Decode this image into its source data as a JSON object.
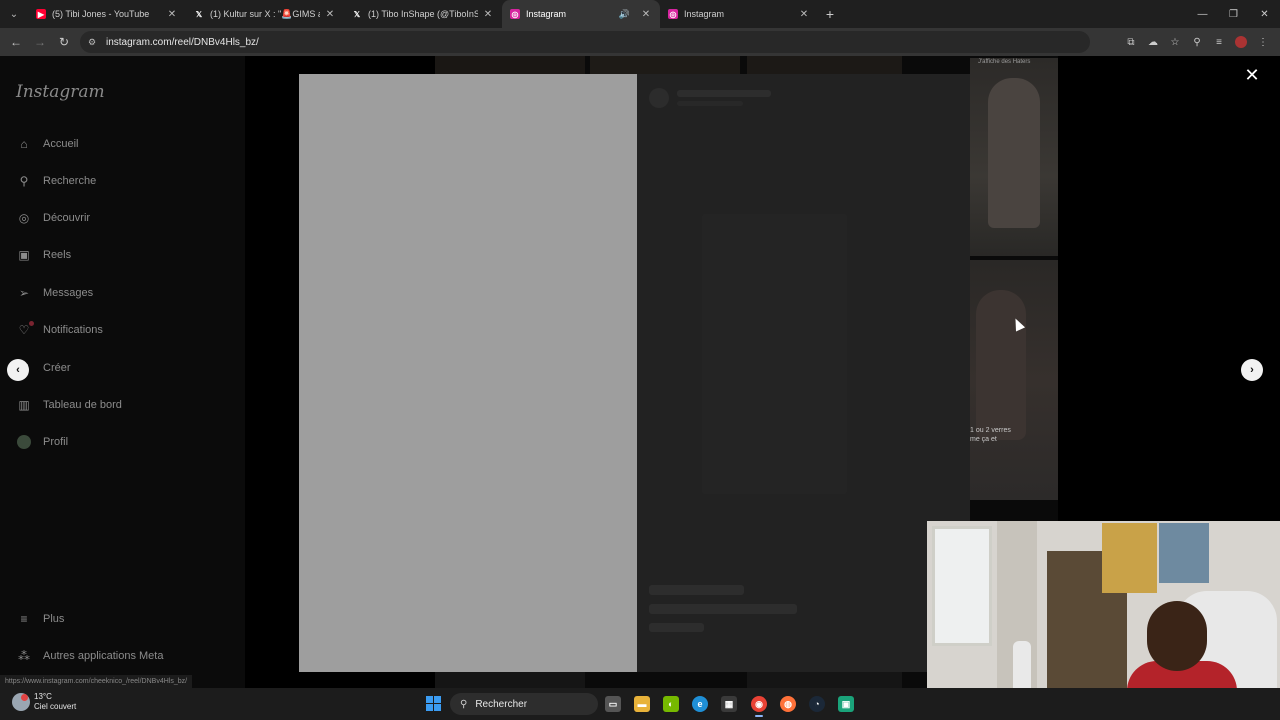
{
  "browser": {
    "tabs": [
      {
        "title": "(5) Tibi Jones - YouTube",
        "favicon": "youtube-icon",
        "color": "#ff0033",
        "active": false,
        "muted": false
      },
      {
        "title": "(1) Kultur sur X : \"🚨GIMS annc",
        "favicon": "x-icon",
        "color": "#000000",
        "active": false,
        "muted": false
      },
      {
        "title": "(1) Tibo InShape (@TiboInShap",
        "favicon": "x-icon",
        "color": "#000000",
        "active": false,
        "muted": false
      },
      {
        "title": "Instagram",
        "favicon": "instagram-icon",
        "color": "#d6249f",
        "active": true,
        "muted": true
      },
      {
        "title": "Instagram",
        "favicon": "instagram-icon",
        "color": "#d6249f",
        "active": false,
        "muted": false
      }
    ],
    "url": "instagram.com/reel/DNBv4Hls_bz/",
    "status_url": "https://www.instagram.com/cheeknico_/reel/DNBv4Hls_bz/"
  },
  "instagram": {
    "logo": "Instagram",
    "nav": [
      {
        "label": "Accueil",
        "icon": "home-icon"
      },
      {
        "label": "Recherche",
        "icon": "search-icon"
      },
      {
        "label": "Découvrir",
        "icon": "compass-icon"
      },
      {
        "label": "Reels",
        "icon": "reels-icon"
      },
      {
        "label": "Messages",
        "icon": "messages-icon"
      },
      {
        "label": "Notifications",
        "icon": "heart-icon"
      },
      {
        "label": "Créer",
        "icon": "plus-square-icon"
      },
      {
        "label": "Tableau de bord",
        "icon": "dashboard-icon"
      },
      {
        "label": "Profil",
        "icon": "avatar"
      }
    ],
    "bottom_nav": [
      {
        "label": "Plus",
        "icon": "menu-icon"
      },
      {
        "label": "Autres applications Meta",
        "icon": "meta-apps-icon"
      }
    ],
    "thumb_caption_top": "J'affiche des Haters",
    "thumb_caption_mid_line1": "1 ou 2 verres",
    "thumb_caption_mid_line2": "me ça et"
  },
  "taskbar": {
    "temperature": "13°C",
    "weather": "Ciel couvert",
    "search_placeholder": "Rechercher",
    "apps": [
      {
        "name": "task-view-icon",
        "color": "#555555"
      },
      {
        "name": "file-explorer-icon",
        "color": "#e8b23a"
      },
      {
        "name": "nvidia-icon",
        "color": "#76b900"
      },
      {
        "name": "edge-icon",
        "color": "#1f8fd6"
      },
      {
        "name": "store-icon",
        "color": "#3a3a3a"
      },
      {
        "name": "chrome-icon",
        "color": "#e94235"
      },
      {
        "name": "firefox-icon",
        "color": "#ff7139"
      },
      {
        "name": "steam-icon",
        "color": "#1b2838"
      },
      {
        "name": "app-icon",
        "color": "#1aa37a"
      }
    ]
  }
}
